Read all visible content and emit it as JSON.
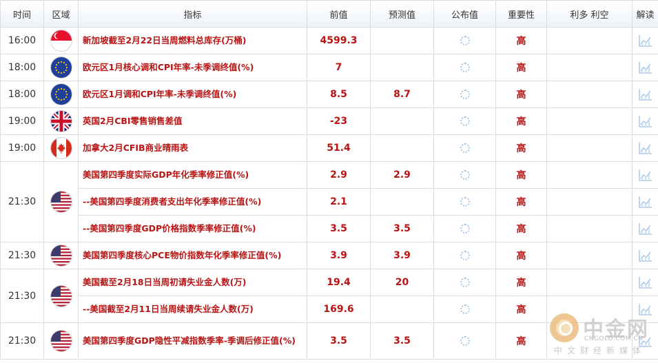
{
  "headers": {
    "time": "时间",
    "region": "区域",
    "indicator": "指标",
    "previous": "前值",
    "forecast": "预测值",
    "actual": "公布值",
    "importance": "重要性",
    "impact": "利多 利空",
    "analysis": "解读"
  },
  "rows": [
    {
      "time": "16:00",
      "flag": "sg-flag-icon",
      "name": "新加坡截至2月22日当周燃料总库存(万桶)",
      "prev": "4599.3",
      "fcst": "",
      "imp": "高"
    },
    {
      "time": "18:00",
      "flag": "eu-flag-icon",
      "name": "欧元区1月核心调和CPI年率-未季调终值(%)",
      "prev": "7",
      "fcst": "",
      "imp": "高"
    },
    {
      "time": "18:00",
      "flag": "eu-flag-icon",
      "name": "欧元区1月调和CPI年率-未季调终值(%)",
      "prev": "8.5",
      "fcst": "8.7",
      "imp": "高"
    },
    {
      "time": "19:00",
      "flag": "uk-flag-icon",
      "name": "英国2月CBI零售销售差值",
      "prev": "-23",
      "fcst": "",
      "imp": "高"
    },
    {
      "time": "19:00",
      "flag": "ca-flag-icon",
      "name": "加拿大2月CFIB商业晴雨表",
      "prev": "51.4",
      "fcst": "",
      "imp": "高"
    },
    {
      "time": "21:30",
      "flag": "us-flag-icon",
      "name": "美国第四季度实际GDP年化季率修正值(%)",
      "prev": "2.9",
      "fcst": "2.9",
      "imp": "高"
    },
    {
      "time": "",
      "flag": "",
      "name": "--美国第四季度消费者支出年化季率修正值(%)",
      "prev": "2.1",
      "fcst": "",
      "imp": "高"
    },
    {
      "time": "",
      "flag": "",
      "name": "--美国第四季度GDP价格指数季率修正值(%)",
      "prev": "3.5",
      "fcst": "3.5",
      "imp": "高"
    },
    {
      "time": "21:30",
      "flag": "us-flag-icon",
      "name": "美国第四季度核心PCE物价指数年化季率修正值(%)",
      "prev": "3.9",
      "fcst": "3.9",
      "imp": "高"
    },
    {
      "time": "21:30",
      "flag": "us-flag-icon",
      "name": "美国截至2月18日当周初请失业金人数(万)",
      "prev": "19.4",
      "fcst": "20",
      "imp": "高"
    },
    {
      "time": "",
      "flag": "",
      "name": "--美国截至2月11日当周续请失业金人数(万)",
      "prev": "169.6",
      "fcst": "",
      "imp": "高"
    },
    {
      "time": "21:30",
      "flag": "us-flag-icon",
      "name": "美国第四季度GDP隐性平减指数季率-季调后修正值(%)",
      "prev": "3.5",
      "fcst": "3.5",
      "imp": "高"
    }
  ],
  "watermark": {
    "title": "中金网",
    "site": "CNGOLD.COM.CN",
    "tagline": "中文财经新媒体"
  },
  "colors": {
    "accent": "#b81414",
    "border": "#dcdcdc",
    "header_bg": "#eef3f8"
  }
}
